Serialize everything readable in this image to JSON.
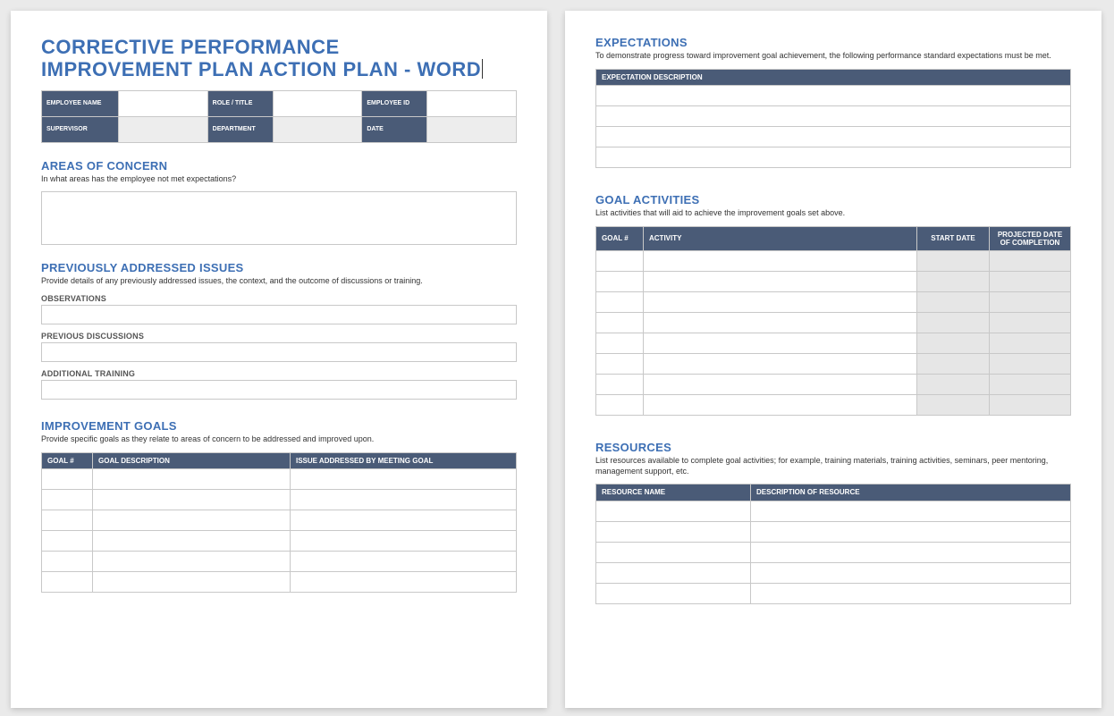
{
  "title_line1": "CORRECTIVE PERFORMANCE",
  "title_line2": "IMPROVEMENT PLAN ACTION PLAN - WORD",
  "meta": {
    "employee_name_label": "EMPLOYEE NAME",
    "role_title_label": "ROLE / TITLE",
    "employee_id_label": "EMPLOYEE ID",
    "supervisor_label": "SUPERVISOR",
    "department_label": "DEPARTMENT",
    "date_label": "DATE"
  },
  "areas": {
    "title": "AREAS OF CONCERN",
    "desc": "In what areas has the employee not met expectations?"
  },
  "previous": {
    "title": "PREVIOUSLY ADDRESSED ISSUES",
    "desc": "Provide details of any previously addressed issues, the context, and the outcome of discussions or training.",
    "observations_label": "OBSERVATIONS",
    "previous_discussions_label": "PREVIOUS DISCUSSIONS",
    "additional_training_label": "ADDITIONAL TRAINING"
  },
  "goals": {
    "title": "IMPROVEMENT GOALS",
    "desc": "Provide specific goals as they relate to areas of concern to be addressed and improved upon.",
    "col_goal_num": "GOAL #",
    "col_goal_desc": "GOAL DESCRIPTION",
    "col_issue": "ISSUE ADDRESSED BY MEETING GOAL"
  },
  "expectations": {
    "title": "EXPECTATIONS",
    "desc": "To demonstrate progress toward improvement goal achievement, the following performance standard expectations must be met.",
    "col_desc": "EXPECTATION DESCRIPTION"
  },
  "activities": {
    "title": "GOAL ACTIVITIES",
    "desc": "List activities that will aid to achieve the improvement goals set above.",
    "col_goal_num": "GOAL #",
    "col_activity": "ACTIVITY",
    "col_start": "START DATE",
    "col_proj": "PROJECTED DATE OF COMPLETION"
  },
  "resources": {
    "title": "RESOURCES",
    "desc": "List resources available to complete goal activities; for example, training materials, training activities, seminars, peer mentoring, management support, etc.",
    "col_name": "RESOURCE NAME",
    "col_desc": "DESCRIPTION OF RESOURCE"
  }
}
